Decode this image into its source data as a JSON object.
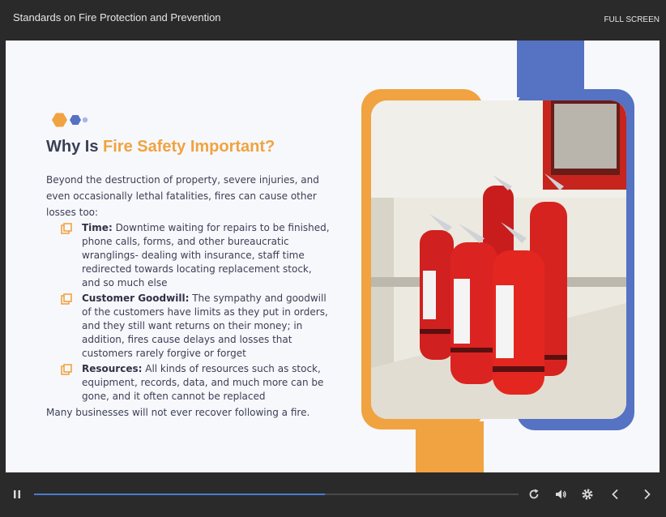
{
  "header": {
    "course_title": "Standards on Fire Protection and Prevention",
    "fullscreen_label": "FULL SCREEN"
  },
  "slide": {
    "heading_prefix": "Why Is ",
    "heading_accent": "Fire Safety Important?",
    "intro": "Beyond the destruction of property, severe injuries, and even occasionally lethal fatalities, fires can cause other losses too:",
    "bullets": [
      {
        "term": "Time:",
        "text": " Downtime waiting for repairs to be finished, phone calls, forms, and other bureaucratic wranglings- dealing with insurance, staff time redirected towards locating replacement stock, and so much else"
      },
      {
        "term": "Customer Goodwill:",
        "text": " The sympathy and goodwill of the customers have limits as they put in orders, and they still want returns on their money; in addition, fires cause delays and losses that customers rarely forgive or forget"
      },
      {
        "term": "Resources:",
        "text": " All kinds of resources such as stock, equipment, records, data, and much more can be gone, and it often cannot be replaced"
      }
    ],
    "outro": "Many businesses will not ever recover following a fire."
  },
  "player": {
    "progress": 0.6
  },
  "colors": {
    "accent_orange": "#f0a340",
    "accent_blue": "#5572c3",
    "text": "#3b3f55",
    "progress": "#4a7bd0"
  },
  "icons": [
    "pause-icon",
    "replay-icon",
    "volume-icon",
    "settings-icon",
    "prev-icon",
    "next-icon",
    "bullet-icon"
  ]
}
